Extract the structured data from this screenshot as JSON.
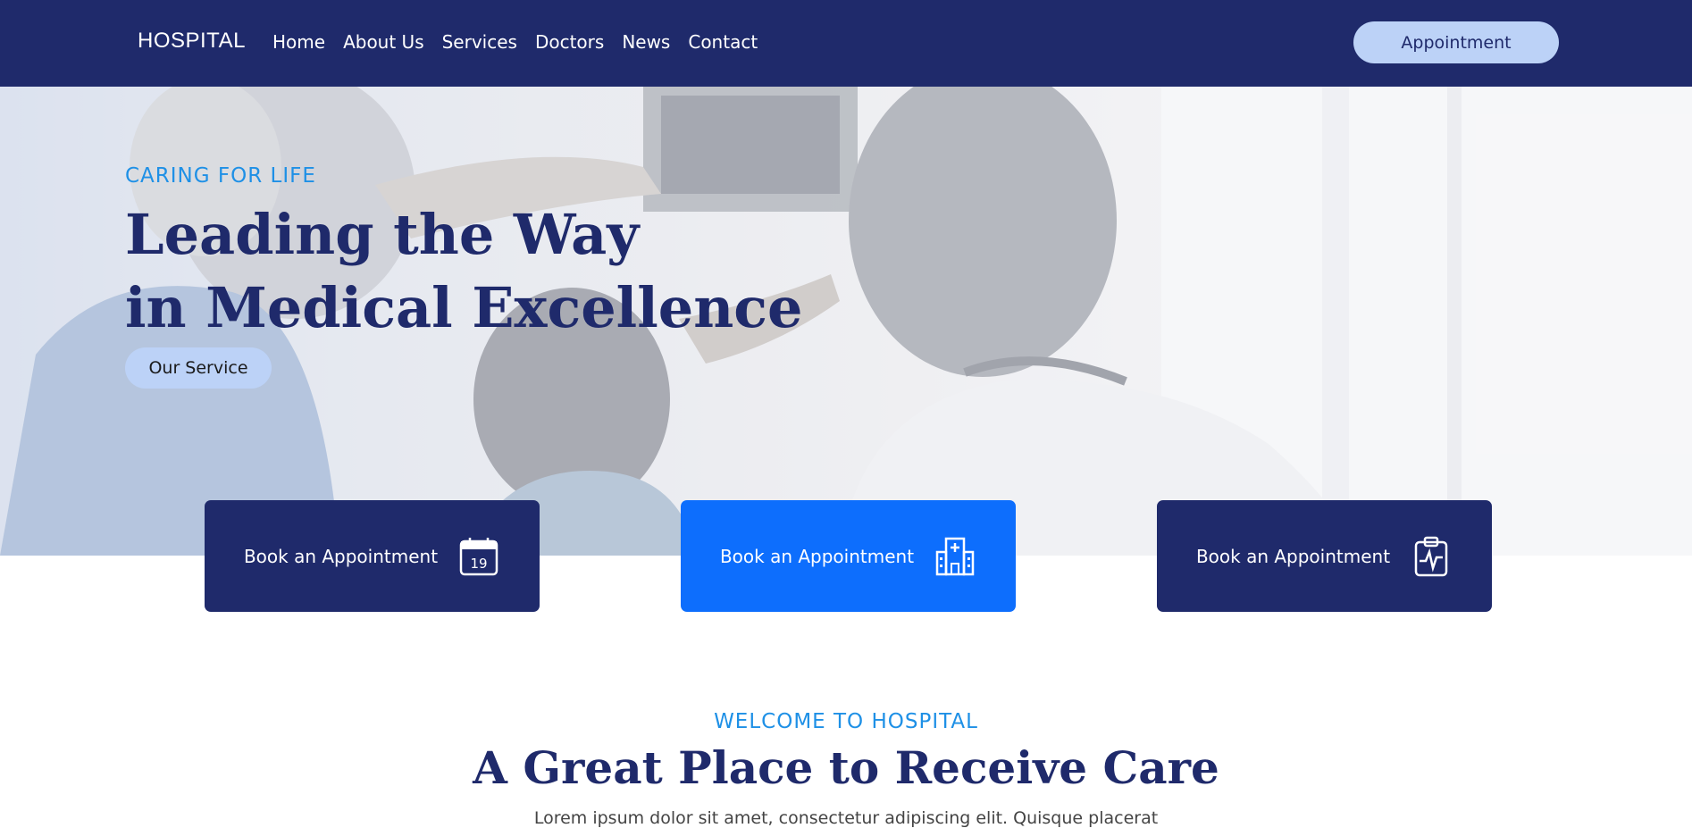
{
  "nav": {
    "brand": "HOSPITAL",
    "links": [
      "Home",
      "About Us",
      "Services",
      "Doctors",
      "News",
      "Contact"
    ],
    "cta": "Appointment"
  },
  "hero": {
    "eyebrow": "CARING FOR LIFE",
    "title_line1": "Leading the Way",
    "title_line2": "in Medical Excellence",
    "button": "Our Service"
  },
  "cards": [
    {
      "label": "Book an Appointment",
      "icon": "calendar-icon",
      "icon_text": "19",
      "color": "#1f2a6b"
    },
    {
      "label": "Book an Appointment",
      "icon": "hospital-icon",
      "color": "#0d6efd"
    },
    {
      "label": "Book an Appointment",
      "icon": "clipboard-pulse-icon",
      "color": "#1f2a6b"
    }
  ],
  "welcome": {
    "eyebrow": "WELCOME TO HOSPITAL",
    "title": "A Great Place to Receive Care",
    "text": "Lorem ipsum dolor sit amet, consectetur adipiscing elit. Quisque placerat"
  },
  "colors": {
    "navy": "#1f2a6b",
    "accent_blue": "#1e90e6",
    "primary_blue": "#0d6efd",
    "light_blue": "#bcd2f7"
  }
}
